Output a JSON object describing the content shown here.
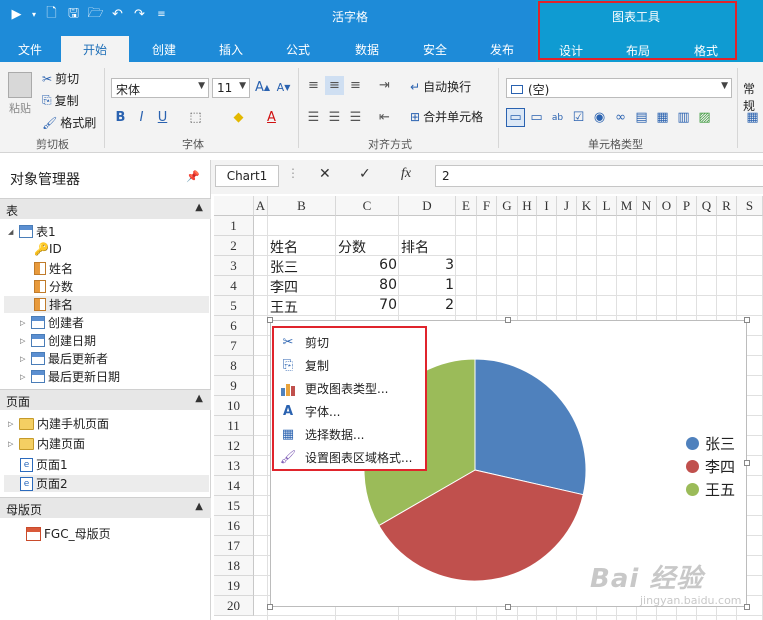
{
  "app": {
    "title": "活字格"
  },
  "menu": {
    "items": [
      "文件",
      "开始",
      "创建",
      "插入",
      "公式",
      "数据",
      "安全",
      "发布"
    ],
    "active": "开始"
  },
  "chart_tools": {
    "header": "图表工具",
    "tabs": [
      "设计",
      "布局",
      "格式"
    ]
  },
  "ribbon": {
    "clipboard": {
      "paste": "粘贴",
      "cut": "剪切",
      "copy": "复制",
      "format_painter": "格式刷",
      "label": "剪切板"
    },
    "font": {
      "family": "宋体",
      "size": "11",
      "label": "字体"
    },
    "align": {
      "wrap": "自动换行",
      "merge": "合并单元格",
      "label": "对齐方式"
    },
    "cell_type": {
      "value": "(空)",
      "label": "单元格类型"
    },
    "extra": "常规"
  },
  "object_manager": {
    "title": "对象管理器",
    "tables_section": "表",
    "table1": "表1",
    "fields": [
      "ID",
      "姓名",
      "分数",
      "排名",
      "创建者",
      "创建日期",
      "最后更新者",
      "最后更新日期"
    ],
    "pages_section": "页面",
    "page_items": [
      "内建手机页面",
      "内建页面",
      "页面1",
      "页面2"
    ],
    "master_section": "母版页",
    "master_items": [
      "FGC_母版页"
    ]
  },
  "formula_bar": {
    "name": "Chart1",
    "value": "2",
    "fx": "fx"
  },
  "sheet": {
    "columns": [
      "A",
      "B",
      "C",
      "D",
      "E",
      "F",
      "G",
      "H",
      "I",
      "J",
      "K",
      "L",
      "M",
      "N",
      "O",
      "P",
      "Q",
      "R",
      "S"
    ],
    "rows": [
      "1",
      "2",
      "3",
      "4",
      "5",
      "6",
      "7",
      "8",
      "9",
      "10",
      "11",
      "12",
      "13",
      "14",
      "15",
      "16",
      "17",
      "18",
      "19",
      "20"
    ],
    "headers": [
      "姓名",
      "分数",
      "排名"
    ],
    "data": [
      [
        "张三",
        "60",
        "3"
      ],
      [
        "李四",
        "80",
        "1"
      ],
      [
        "王五",
        "70",
        "2"
      ]
    ]
  },
  "chart_data": {
    "type": "pie",
    "categories": [
      "张三",
      "李四",
      "王五"
    ],
    "values": [
      60,
      80,
      70
    ],
    "colors": [
      "#4f81bd",
      "#c0504d",
      "#9bbb59"
    ],
    "legend": "right"
  },
  "context_menu": {
    "items": [
      "剪切",
      "复制",
      "更改图表类型...",
      "字体...",
      "选择数据...",
      "设置图表区域格式..."
    ]
  },
  "watermark": {
    "main": "Bai 经验",
    "sub": "jingyan.baidu.com"
  }
}
